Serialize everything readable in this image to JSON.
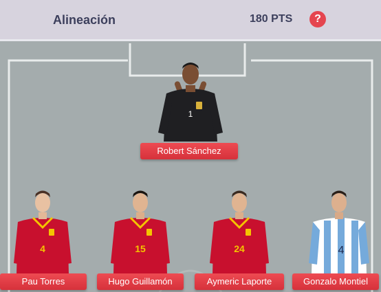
{
  "header": {
    "title": "Alineación",
    "points": "180 PTS",
    "help_label": "?"
  },
  "players": [
    {
      "name": "Robert Sánchez",
      "number": "1",
      "kit": "goalkeeper-black"
    },
    {
      "name": "Pau Torres",
      "number": "4",
      "kit": "spain-red"
    },
    {
      "name": "Hugo Guillamón",
      "number": "15",
      "kit": "spain-red"
    },
    {
      "name": "Aymeric Laporte",
      "number": "24",
      "kit": "spain-red"
    },
    {
      "name": "Gonzalo Montiel",
      "number": "4",
      "kit": "argentina-stripes"
    }
  ],
  "colors": {
    "accent": "#e5454f",
    "pitch": "#a4acad",
    "header_bg": "#d7d3de",
    "title_text": "#3c3f5c",
    "spain_red": "#c8102e",
    "argentina_blue": "#75aadb"
  }
}
